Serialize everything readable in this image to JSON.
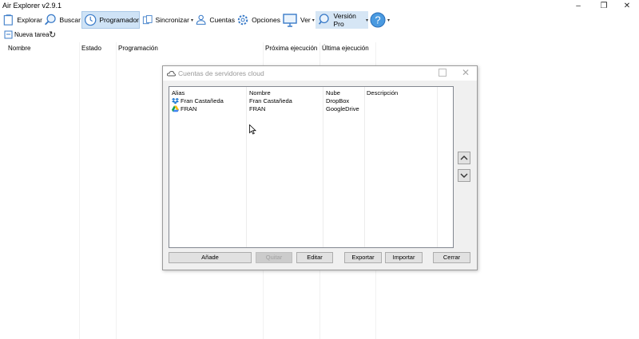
{
  "window": {
    "title": "Air Explorer v2.9.1"
  },
  "toolbar": {
    "explorar": "Explorar",
    "buscar": "Buscar",
    "programador": "Programador",
    "sincronizar": "Sincronizar",
    "cuentas": "Cuentas",
    "opciones": "Opciones",
    "ver": "Ver",
    "version_pro": "Versión Pro"
  },
  "tasks": {
    "new_task": "Nueva tarea"
  },
  "main_columns": [
    "Nombre",
    "Estado",
    "Programación",
    "Próxima ejecución",
    "Última ejecución"
  ],
  "dialog": {
    "title": "Cuentas de servidores cloud",
    "columns": [
      "Alias",
      "Nombre",
      "Nube",
      "Descripción"
    ],
    "rows": [
      {
        "alias": "Fran Castañeda",
        "nombre": "Fran Castañeda",
        "nube": "DropBox",
        "descripcion": "",
        "icon": "dropbox-icon"
      },
      {
        "alias": "FRAN",
        "nombre": "FRAN",
        "nube": "GoogleDrive",
        "descripcion": "",
        "icon": "google-drive-icon"
      }
    ],
    "buttons": {
      "add": "Añade",
      "remove": "Quitar",
      "edit": "Editar",
      "export": "Exportar",
      "import": "Importar",
      "close": "Cerrar"
    }
  },
  "colors": {
    "accent": "#4a90d9",
    "active_bg": "#cfe3f6",
    "dialog_bg": "#f0f0f0"
  }
}
